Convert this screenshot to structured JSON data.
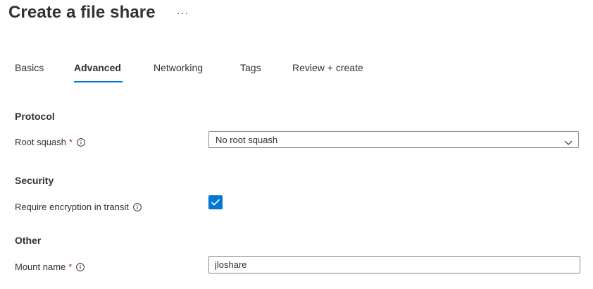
{
  "header": {
    "title": "Create a file share",
    "more_label": "···"
  },
  "tabs": [
    {
      "label": "Basics",
      "active": false
    },
    {
      "label": "Advanced",
      "active": true
    },
    {
      "label": "Networking",
      "active": false
    },
    {
      "label": "Tags",
      "active": false
    },
    {
      "label": "Review + create",
      "active": false
    }
  ],
  "protocol": {
    "heading": "Protocol",
    "root_squash": {
      "label": "Root squash",
      "required_marker": "*",
      "value": "No root squash"
    }
  },
  "security": {
    "heading": "Security",
    "encryption": {
      "label": "Require encryption in transit",
      "checked": true
    }
  },
  "other": {
    "heading": "Other",
    "mount_name": {
      "label": "Mount name",
      "required_marker": "*",
      "value": "jloshare"
    }
  },
  "colors": {
    "accent": "#0078d4",
    "text": "#323130",
    "required": "#a4262c",
    "border": "#8a8886"
  },
  "icons": {
    "info": "info-icon",
    "dropdown": "chevron-down-icon",
    "check": "checkmark-icon"
  }
}
